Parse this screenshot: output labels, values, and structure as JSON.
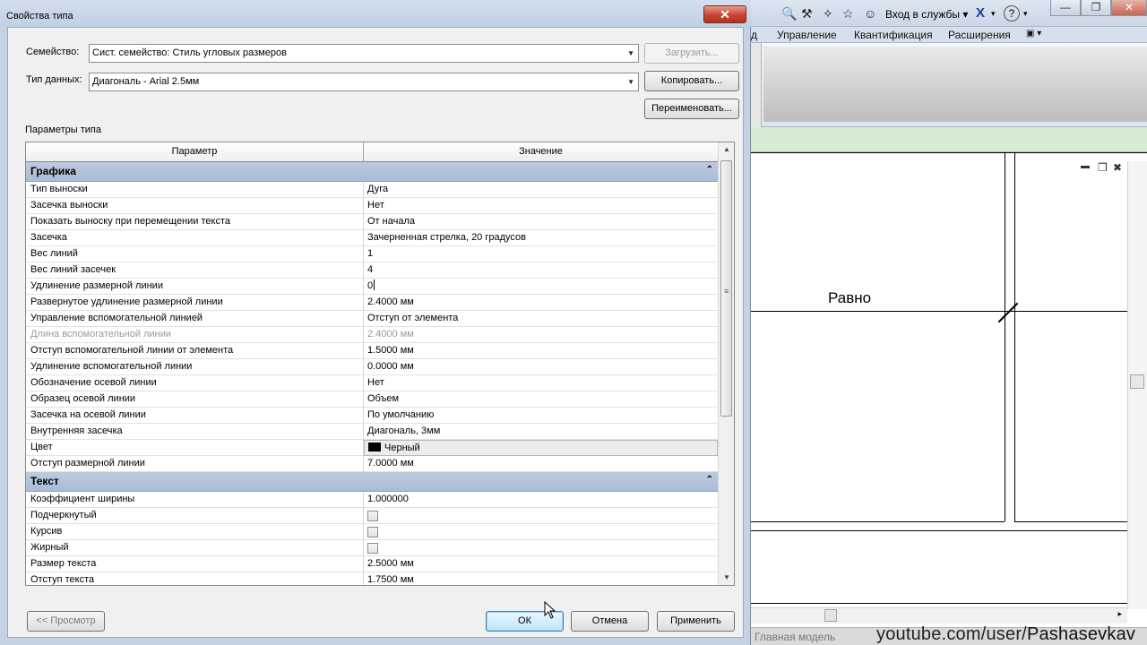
{
  "dialog": {
    "title": "Свойства типа",
    "family_label": "Семейство:",
    "family_value": "Сист. семейство: Стиль угловых размеров",
    "type_label": "Тип данных:",
    "type_value": "Диагональ - Arial 2.5мм",
    "load_button": "Загрузить...",
    "copy_button": "Копировать...",
    "rename_button": "Переименовать...",
    "params_label": "Параметры типа",
    "col_param": "Параметр",
    "col_value": "Значение",
    "preview_button": "<< Просмотр",
    "ok_button": "ОК",
    "cancel_button": "Отмена",
    "apply_button": "Применить",
    "groups": [
      {
        "name": "Графика",
        "rows": [
          {
            "param": "Тип выноски",
            "value": "Дуга"
          },
          {
            "param": "Засечка выноски",
            "value": "Нет"
          },
          {
            "param": "Показать выноску при перемещении текста",
            "value": "От начала"
          },
          {
            "param": "Засечка",
            "value": "Зачерненная стрелка, 20 градусов"
          },
          {
            "param": "Вес линий",
            "value": "1"
          },
          {
            "param": "Вес линий засечек",
            "value": "4"
          },
          {
            "param": "Удлинение размерной линии",
            "value": "0"
          },
          {
            "param": "Развернутое удлинение размерной линии",
            "value": "2.4000 мм"
          },
          {
            "param": "Управление вспомогательной линией",
            "value": "Отступ от элемента"
          },
          {
            "param": "Длина вспомогательной линии",
            "value": "2.4000 мм"
          },
          {
            "param": "Отступ вспомогательной линии от элемента",
            "value": "1.5000 мм"
          },
          {
            "param": "Удлинение вспомогательной линии",
            "value": "0.0000 мм"
          },
          {
            "param": "Обозначение осевой линии",
            "value": "Нет"
          },
          {
            "param": "Образец осевой линии",
            "value": "Объем"
          },
          {
            "param": "Засечка на осевой линии",
            "value": "По умолчанию"
          },
          {
            "param": "Внутренняя засечка",
            "value": "Диагональ, 3мм"
          },
          {
            "param": "Цвет",
            "value": "Черный"
          },
          {
            "param": "Отступ размерной линии",
            "value": "7.0000 мм"
          }
        ]
      },
      {
        "name": "Текст",
        "rows": [
          {
            "param": "Коэффициент ширины",
            "value": "1.000000"
          },
          {
            "param": "Подчеркнутый",
            "value": ""
          },
          {
            "param": "Курсив",
            "value": ""
          },
          {
            "param": "Жирный",
            "value": ""
          },
          {
            "param": "Размер текста",
            "value": "2.5000 мм"
          },
          {
            "param": "Отступ текста",
            "value": "1.7500 мм"
          }
        ]
      }
    ]
  },
  "background": {
    "login_label": "Вход в службы",
    "ribbon_tab_fragment": "д",
    "ribbon_tabs": [
      "Управление",
      "Квантификация",
      "Расширения"
    ],
    "view_annotation": "Равно",
    "status_text": "Главная модель",
    "watermark_prefix": "youtube.com/user/",
    "watermark_name": "Pashasevkav"
  }
}
